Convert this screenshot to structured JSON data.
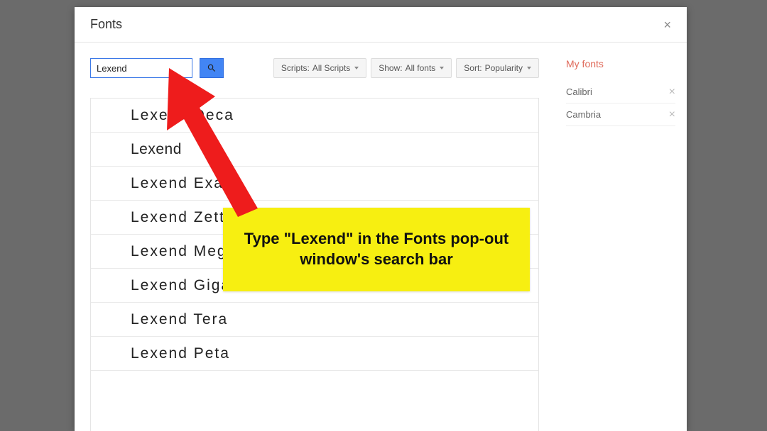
{
  "dialog": {
    "title": "Fonts",
    "close_glyph": "×"
  },
  "search": {
    "value": "Lexend"
  },
  "filters": {
    "scripts": {
      "label": "Scripts:",
      "value": "All Scripts"
    },
    "show": {
      "label": "Show:",
      "value": "All fonts"
    },
    "sort": {
      "label": "Sort:",
      "value": "Popularity"
    }
  },
  "font_results": [
    "Lexend Deca",
    "Lexend",
    "Lexend Exa",
    "Lexend Zetta",
    "Lexend Mega",
    "Lexend Giga",
    "Lexend Tera",
    "Lexend Peta"
  ],
  "sidebar": {
    "title": "My fonts",
    "items": [
      {
        "name": "Calibri",
        "remove": "×"
      },
      {
        "name": "Cambria",
        "remove": "×"
      }
    ]
  },
  "annotation": {
    "text": "Type \"Lexend\" in the Fonts pop-out window's search bar"
  }
}
